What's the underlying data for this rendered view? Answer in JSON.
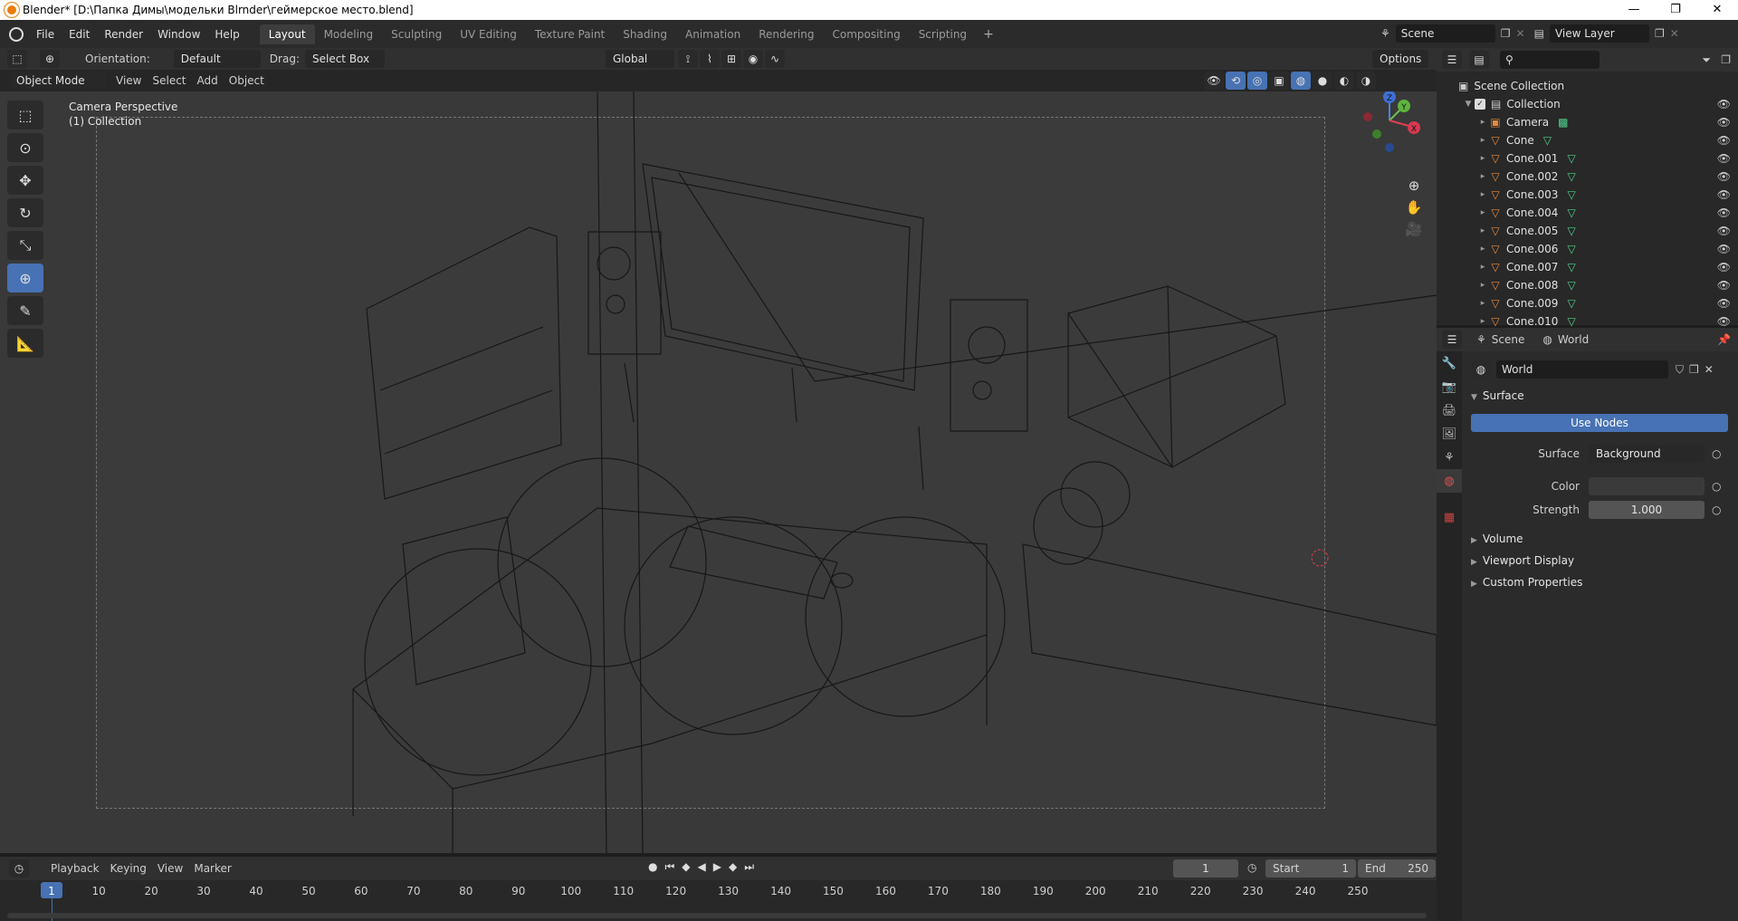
{
  "titlebar": {
    "title": "Blender* [D:\\Папка Димы\\модельки Blrnder\\геймерское место.blend]",
    "minimize": "—",
    "maximize": "❐",
    "close": "✕"
  },
  "menu": {
    "items": [
      "File",
      "Edit",
      "Render",
      "Window",
      "Help"
    ]
  },
  "workspaces": {
    "tabs": [
      "Layout",
      "Modeling",
      "Sculpting",
      "UV Editing",
      "Texture Paint",
      "Shading",
      "Animation",
      "Rendering",
      "Compositing",
      "Scripting"
    ],
    "active": "Layout",
    "add": "+"
  },
  "scene": {
    "name": "Scene",
    "view_layer": "View Layer"
  },
  "toolheader": {
    "orientation_label": "Orientation:",
    "orientation_value": "Default",
    "drag_label": "Drag:",
    "drag_value": "Select Box",
    "transform_orientation": "Global",
    "options": "Options"
  },
  "viewheader": {
    "mode": "Object Mode",
    "menus": [
      "View",
      "Select",
      "Add",
      "Object"
    ]
  },
  "viewport": {
    "camera_label": "Camera Perspective",
    "collection_label": "(1) Collection",
    "gizmo_axes": [
      "Z",
      "Y",
      "X"
    ]
  },
  "timeline": {
    "menus": [
      "Playback",
      "Keying",
      "View",
      "Marker"
    ],
    "current_frame": "1",
    "start_label": "Start",
    "start_value": "1",
    "end_label": "End",
    "end_value": "250",
    "ruler": [
      "1",
      "10",
      "20",
      "30",
      "40",
      "50",
      "60",
      "70",
      "80",
      "90",
      "100",
      "110",
      "120",
      "130",
      "140",
      "150",
      "160",
      "170",
      "180",
      "190",
      "200",
      "210",
      "220",
      "230",
      "240",
      "250"
    ]
  },
  "outliner": {
    "scene_collection": "Scene Collection",
    "collection": "Collection",
    "objects": [
      "Camera",
      "Cone",
      "Cone.001",
      "Cone.002",
      "Cone.003",
      "Cone.004",
      "Cone.005",
      "Cone.006",
      "Cone.007",
      "Cone.008",
      "Cone.009",
      "Cone.010"
    ]
  },
  "properties": {
    "tabs_header": [
      "Scene",
      "World"
    ],
    "world_name": "World",
    "surface_section": "Surface",
    "use_nodes": "Use Nodes",
    "surface_label": "Surface",
    "surface_value": "Background",
    "color_label": "Color",
    "strength_label": "Strength",
    "strength_value": "1.000",
    "collapsed_sections": [
      "Volume",
      "Viewport Display",
      "Custom Properties"
    ]
  },
  "colors": {
    "accent": "#4772b3",
    "cone_icon": "#e7893a",
    "mesh_icon": "#4fd18b",
    "viewport_bg": "#393939"
  }
}
